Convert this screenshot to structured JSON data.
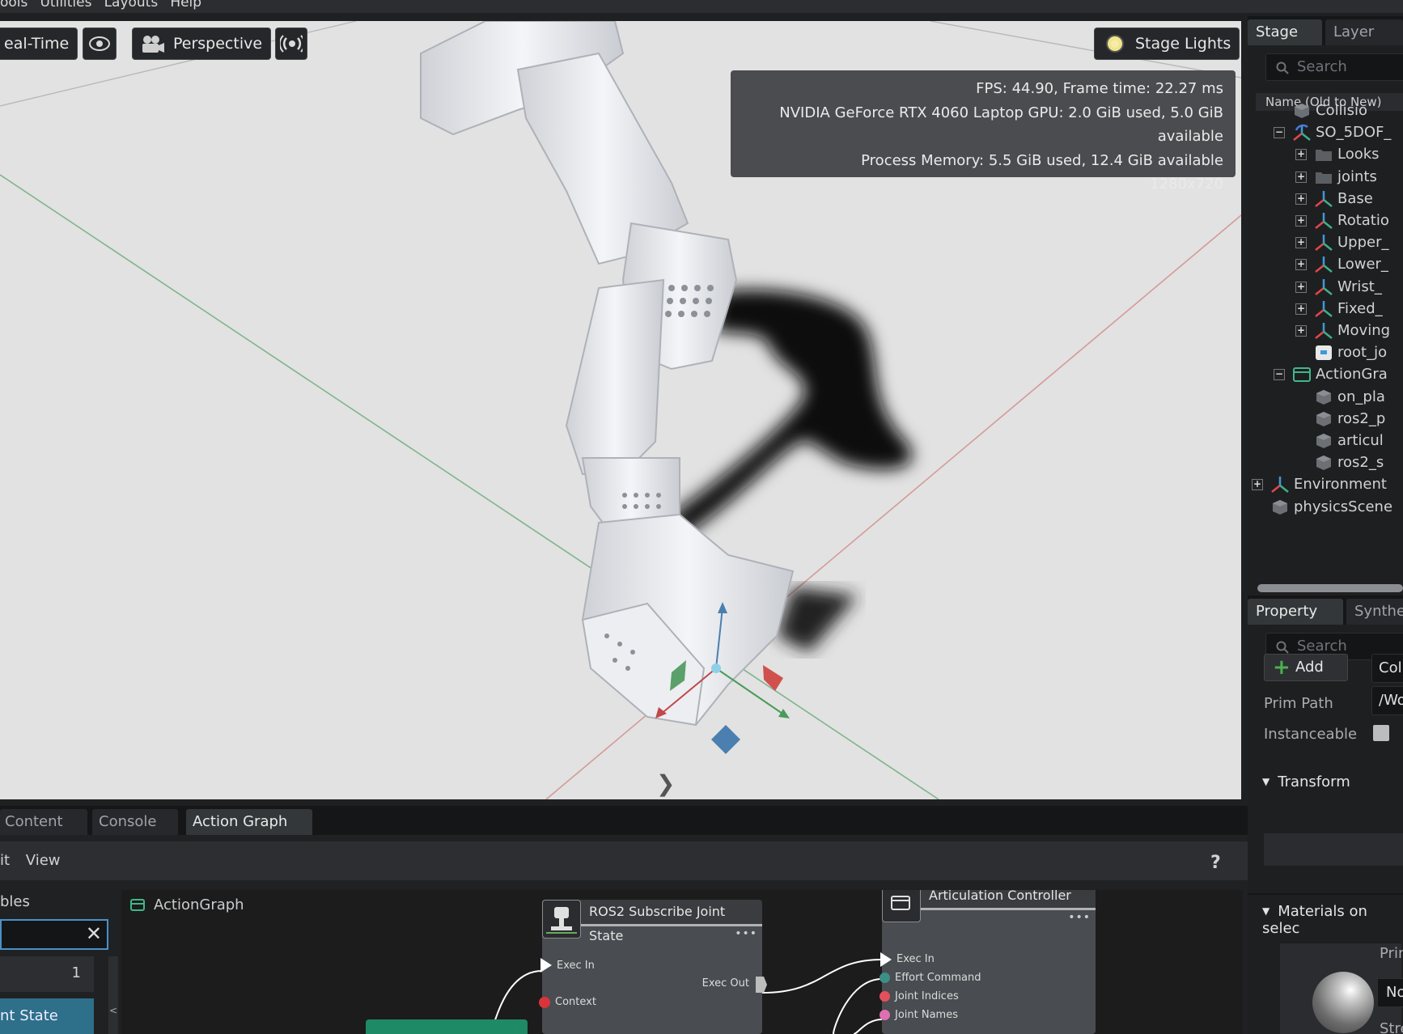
{
  "menubar": {
    "items": [
      "ools",
      "Utilities",
      "Layouts",
      "Help"
    ]
  },
  "viewport": {
    "realtime_label": "eal-Time",
    "camera_label": "Perspective",
    "lights_label": "Stage Lights",
    "stats": [
      "FPS: 44.90, Frame time: 22.27 ms",
      "NVIDIA GeForce RTX 4060 Laptop GPU: 2.0 GiB used, 5.0 GiB available",
      "Process Memory: 5.5 GiB used, 12.4 GiB available",
      "1280x720"
    ]
  },
  "stage": {
    "tabs": [
      "Stage",
      "Layer"
    ],
    "search_placeholder": "Search",
    "column_header": "Name (Old to New)",
    "tree": [
      {
        "label": "Collisio",
        "icon": "cube-icon"
      },
      {
        "label": "SO_5DOF_",
        "icon": "articulation-icon",
        "expander": "−"
      },
      {
        "label": "Looks",
        "icon": "folder-icon",
        "expander": "+"
      },
      {
        "label": "joints",
        "icon": "folder-icon",
        "expander": "+"
      },
      {
        "label": "Base",
        "icon": "xform-icon",
        "expander": "+"
      },
      {
        "label": "Rotatio",
        "icon": "xform-icon",
        "expander": "+"
      },
      {
        "label": "Upper_",
        "icon": "xform-icon",
        "expander": "+"
      },
      {
        "label": "Lower_",
        "icon": "xform-icon",
        "expander": "+"
      },
      {
        "label": "Wrist_",
        "icon": "xform-icon",
        "expander": "+"
      },
      {
        "label": "Fixed_",
        "icon": "xform-icon",
        "expander": "+"
      },
      {
        "label": "Moving",
        "icon": "xform-icon",
        "expander": "+"
      },
      {
        "label": "root_jo",
        "icon": "joint-icon"
      },
      {
        "label": "ActionGra",
        "icon": "action-graph-icon",
        "expander": "−"
      },
      {
        "label": "on_pla",
        "icon": "cube-icon"
      },
      {
        "label": "ros2_p",
        "icon": "cube-icon"
      },
      {
        "label": "articul",
        "icon": "cube-icon"
      },
      {
        "label": "ros2_s",
        "icon": "cube-icon"
      },
      {
        "label": "Environment",
        "icon": "xform-icon",
        "expander": "+"
      },
      {
        "label": "physicsScene",
        "icon": "cube-icon"
      }
    ]
  },
  "property": {
    "tabs": [
      "Property",
      "Synthe"
    ],
    "search_placeholder": "Search",
    "add_label": "Add",
    "add_field_value": "Coll",
    "prim_path_label": "Prim Path",
    "prim_path_value": "/Wo",
    "instanceable_label": "Instanceable",
    "transform_label": "Transform",
    "materials_label": "Materials on selec",
    "material_side_1": "Prin",
    "material_side_2": "No",
    "material_side_3": "Stre"
  },
  "bottom": {
    "tabs": [
      "Content",
      "Console",
      "Action Graph"
    ],
    "menu": [
      "it",
      "View"
    ],
    "help": "?",
    "left_header": "bles",
    "left_value": "1",
    "left_selected": "nt State",
    "collapse_arrow": "<",
    "graph_title": "ActionGraph",
    "nodes": {
      "subscribe": {
        "title": "ROS2 Subscribe Joint State",
        "ports": [
          "Exec In",
          "Exec Out",
          "Context"
        ]
      },
      "controller": {
        "title": "Articulation Controller",
        "ports": [
          "Exec In",
          "Effort Command",
          "Joint Indices",
          "Joint Names"
        ]
      }
    }
  }
}
